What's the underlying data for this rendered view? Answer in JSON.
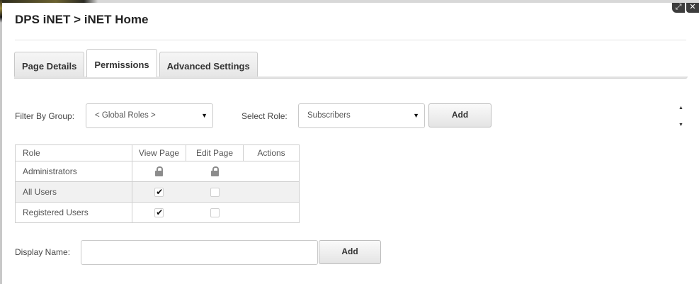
{
  "title": "DPS iNET > iNET Home",
  "tabs": [
    {
      "label": "Page Details",
      "active": false
    },
    {
      "label": "Permissions",
      "active": true
    },
    {
      "label": "Advanced Settings",
      "active": false
    }
  ],
  "filter": {
    "label": "Filter By Group:",
    "value": "< Global Roles >",
    "arrow_icon": "triangle-down-icon"
  },
  "role_select": {
    "label": "Select Role:",
    "value": "Subscribers",
    "arrow_icon": "triangle-down-icon",
    "add_label": "Add"
  },
  "table": {
    "headers": [
      "Role",
      "View Page",
      "Edit Page",
      "Actions"
    ],
    "rows": [
      {
        "role": "Administrators",
        "view": "locked",
        "edit": "locked"
      },
      {
        "role": "All Users",
        "view": "checked",
        "edit": "unchecked"
      },
      {
        "role": "Registered Users",
        "view": "checked",
        "edit": "unchecked"
      }
    ]
  },
  "display_name": {
    "label": "Display Name:",
    "value": "",
    "add_label": "Add"
  },
  "window_controls": {
    "maximize": "⤢",
    "close": "✕"
  },
  "colors": {
    "row_shade": "#f1f1f1",
    "border": "#cfcfcf",
    "lock": "#8c8c8c"
  }
}
